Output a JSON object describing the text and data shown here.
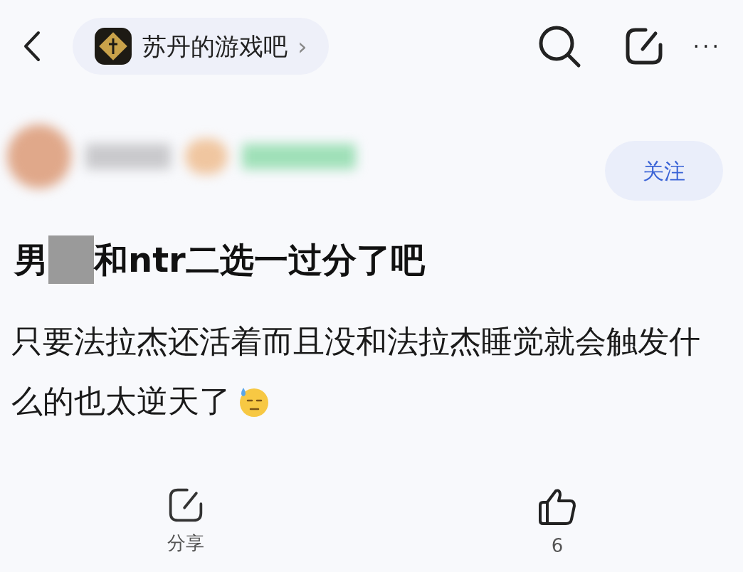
{
  "top_bar": {
    "forum_name": "苏丹的游戏吧",
    "forum_arrow": "›",
    "more": "···"
  },
  "author": {
    "follow_button": "关注",
    "blurred": true
  },
  "post": {
    "title_before": "男",
    "title_redacted": true,
    "title_after": "和ntr二选一过分了吧",
    "body": "只要法拉杰还活着而且没和法拉杰睡觉就会触发什么的也太逆天了"
  },
  "actions": [
    {
      "kind": "share",
      "label": "分享"
    },
    {
      "kind": "like",
      "label": "6"
    }
  ]
}
